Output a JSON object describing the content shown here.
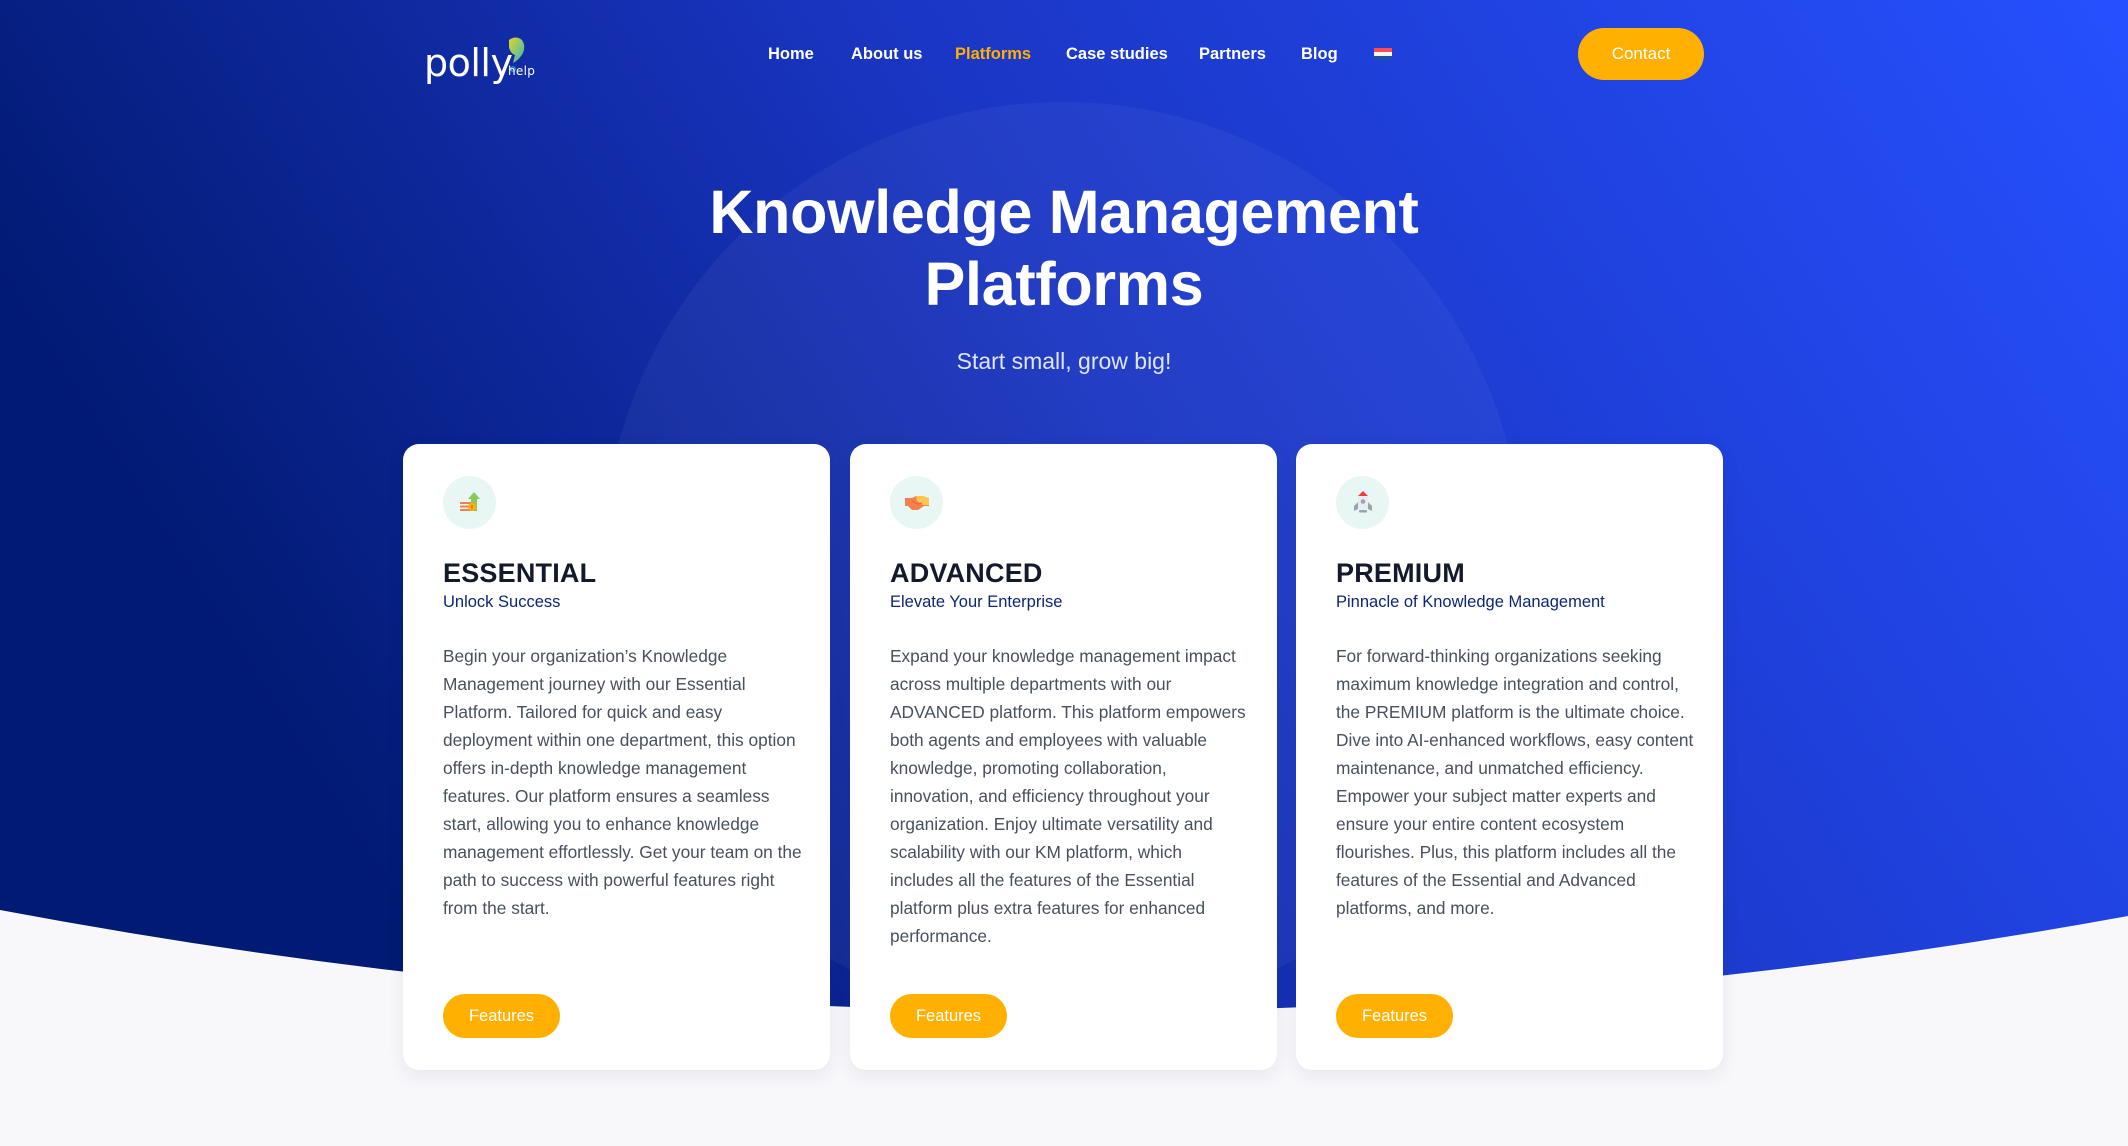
{
  "brand": {
    "logo_word": "polly",
    "logo_suffix": "help"
  },
  "nav": {
    "items": [
      {
        "label": "Home",
        "active": false
      },
      {
        "label": "About us",
        "active": false
      },
      {
        "label": "Platforms",
        "active": true
      },
      {
        "label": "Case studies",
        "active": false
      },
      {
        "label": "Partners",
        "active": false
      },
      {
        "label": "Blog",
        "active": false
      }
    ],
    "language_icon": "netherlands-flag-icon",
    "contact_label": "Contact"
  },
  "hero": {
    "title_line1": "Knowledge Management",
    "title_line2": "Platforms",
    "subtitle": "Start small, grow big!"
  },
  "colors": {
    "accent": "#ffb000",
    "hero_gradient_start": "#011a73",
    "hero_gradient_end": "#2550fb",
    "page_background": "#f8f8fb",
    "card_title": "#131a2b",
    "card_subtitle": "#0d2577",
    "card_body": "#48505e",
    "icon_circle": "#e8f6f4"
  },
  "cards": [
    {
      "icon": "growth-arrow-icon",
      "title": "ESSENTIAL",
      "subtitle": "Unlock Success",
      "body": "Begin your organization’s Knowledge Management journey with our Essential Platform. Tailored for quick and easy deployment within one department, this option offers in-depth knowledge management features. Our platform ensures a seamless start, allowing you to enhance knowledge management effortlessly. Get your team on the path to success with powerful features right from the start.",
      "button_label": "Features"
    },
    {
      "icon": "handshake-icon",
      "title": "ADVANCED",
      "subtitle": "Elevate Your Enterprise",
      "body": "Expand your knowledge management impact across multiple departments with our ADVANCED platform. This platform empowers both agents and employees with valuable knowledge, promoting collaboration, innovation, and efficiency throughout your organization. Enjoy ultimate versatility and scalability with our KM platform, which includes all the features of the Essential platform plus extra features for enhanced performance.",
      "button_label": "Features"
    },
    {
      "icon": "rocket-icon",
      "title": "PREMIUM",
      "subtitle": "Pinnacle of Knowledge Management",
      "body": "For forward-thinking organizations seeking maximum knowledge integration and control, the PREMIUM platform is the ultimate choice. Dive into AI-enhanced workflows, easy content maintenance, and unmatched efficiency. Empower your subject matter experts and ensure your entire content ecosystem flourishes. Plus, this platform includes all the features of the Essential and Advanced platforms, and more.",
      "button_label": "Features"
    }
  ]
}
